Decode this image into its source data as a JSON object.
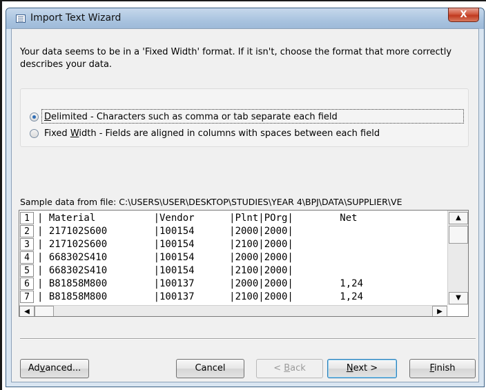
{
  "window": {
    "title": "Import Text Wizard",
    "close_label": "X",
    "app_icon": "import-wizard-icon"
  },
  "intro_text": "Your data seems to be in a 'Fixed Width' format. If it isn't, choose the format that more correctly describes your data.",
  "options": {
    "delimited": {
      "key": "D",
      "rest": "elimited - Characters such as comma or tab separate each field",
      "selected": true
    },
    "fixed_width": {
      "pre": "Fixed ",
      "key": "W",
      "rest": "idth - Fields are aligned in columns with spaces between each field",
      "selected": false
    }
  },
  "sample": {
    "label": "Sample data from file: C:\\USERS\\USER\\DESKTOP\\STUDIES\\YEAR 4\\BPJ\\DATA\\SUPPLIER\\VE",
    "rows": [
      {
        "num": "1",
        "text": "| Material          |Vendor      |Plnt|POrg|        Net "
      },
      {
        "num": "2",
        "text": "| 217102S600        |100154      |2000|2000|            "
      },
      {
        "num": "3",
        "text": "| 217102S600        |100154      |2100|2000|            "
      },
      {
        "num": "4",
        "text": "| 668302S410        |100154      |2000|2000|            "
      },
      {
        "num": "5",
        "text": "| 668302S410        |100154      |2100|2000|            "
      },
      {
        "num": "6",
        "text": "| B81858M800        |100137      |2000|2000|        1,24"
      },
      {
        "num": "7",
        "text": "| B81858M800        |100137      |2100|2000|        1,24"
      }
    ]
  },
  "buttons": {
    "advanced": {
      "pre": "Ad",
      "key": "v",
      "rest": "anced..."
    },
    "cancel": "Cancel",
    "back": {
      "pre": "< ",
      "key": "B",
      "rest": "ack"
    },
    "next": {
      "key": "N",
      "rest": "ext >"
    },
    "finish": {
      "key": "F",
      "rest": "inish"
    }
  },
  "colors": {
    "title_bar": "#a9c3df",
    "close_button": "#c0391f",
    "default_button_border": "#2e7fb8",
    "radio_selected": "#2f6db5"
  }
}
